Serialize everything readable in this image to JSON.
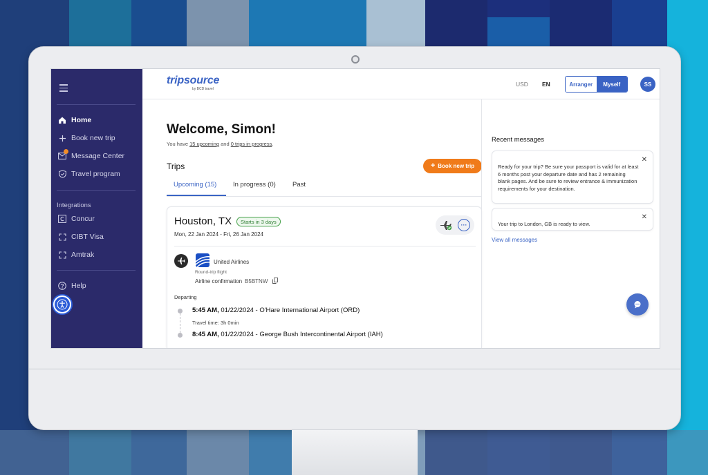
{
  "colors": {
    "sidebar_bg": "#2b2a6a",
    "accent": "#3a63c4",
    "book_button": "#f07b1a",
    "status_green": "#2e7d32"
  },
  "sidebar": {
    "menu_icon": "hamburger-icon",
    "nav": [
      {
        "label": "Home",
        "icon": "home-icon",
        "active": true
      },
      {
        "label": "Book new trip",
        "icon": "plus-icon"
      },
      {
        "label": "Message Center",
        "icon": "mail-icon"
      },
      {
        "label": "Travel program",
        "icon": "shield-icon"
      }
    ],
    "integrations_label": "Integrations",
    "integrations": [
      {
        "label": "Concur",
        "icon": "concur-icon"
      },
      {
        "label": "CIBT Visa",
        "icon": "expand-icon"
      },
      {
        "label": "Amtrak",
        "icon": "expand-icon"
      }
    ],
    "help_label": "Help"
  },
  "header": {
    "logo": "tripsource",
    "logo_sub": "by BCD travel",
    "currency": "USD",
    "language": "EN",
    "toggle": {
      "arranger": "Arranger",
      "myself": "Myself"
    },
    "avatar_initials": "SS"
  },
  "main": {
    "welcome": "Welcome, Simon!",
    "sub_prefix": "You have ",
    "sub_upcoming": "15 upcoming",
    "sub_middle": " and ",
    "sub_progress": "0 trips in progress",
    "sub_suffix": ".",
    "trips_title": "Trips",
    "book_button": "Book new trip",
    "tabs": [
      "Upcoming (15)",
      "In progress (0)",
      "Past"
    ]
  },
  "trip_card": {
    "city": "Houston, TX",
    "status": "Starts in 3 days",
    "dates": "Mon, 22 Jan 2024 - Fri, 26 Jan 2024",
    "airline": "United Airlines",
    "flight_type": "Round-trip flight",
    "confirmation_label": "Airline confirmation",
    "confirmation_code": "B5BTNW",
    "departing_label": "Departing",
    "departure": {
      "time": "5:45 AM,",
      "rest": " 01/22/2024 - O'Hare International Airport (ORD)"
    },
    "travel_time": "Travel time: 3h 0min",
    "arrival": {
      "time": "8:45 AM,",
      "rest": " 01/22/2024 - George Bush Intercontinental Airport (IAH)"
    }
  },
  "recent_messages": {
    "title": "Recent messages",
    "messages": [
      "Ready for your trip? Be sure your passport is valid for at least 6 months post your departure date and has 2 remaining blank pages. And be sure to review entrance & immunization requirements for your destination.",
      "Your trip to London, GB is ready to view."
    ],
    "view_all": "View all messages"
  }
}
